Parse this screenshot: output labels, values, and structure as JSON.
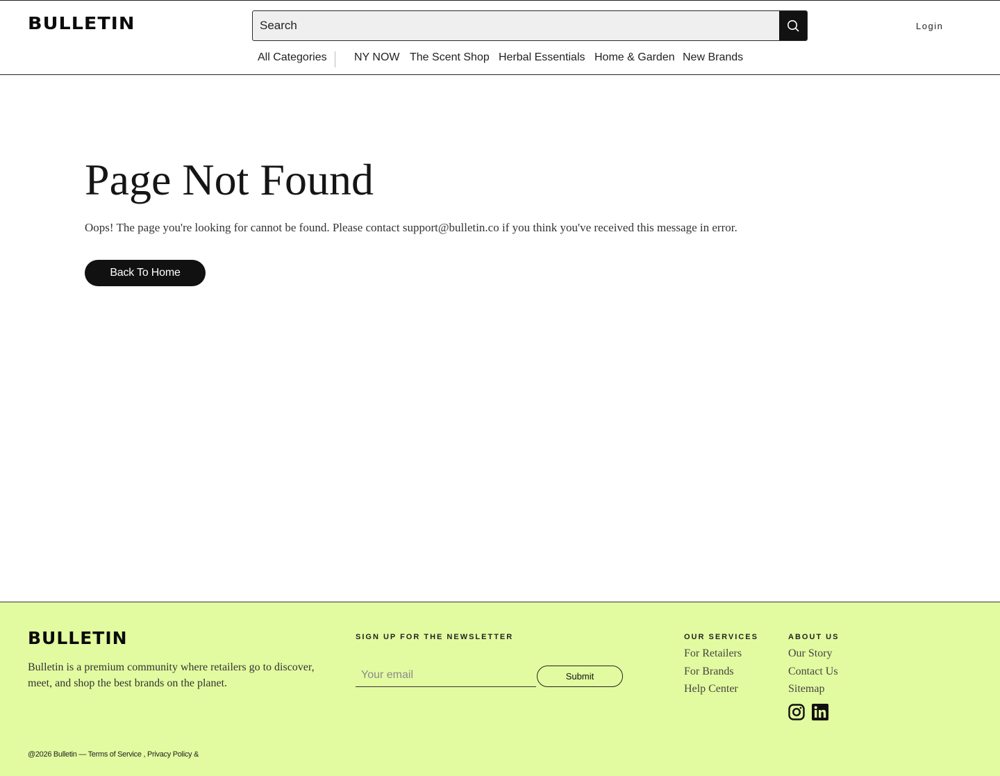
{
  "header": {
    "logo": "BULLETIN",
    "search": {
      "placeholder": "Search"
    },
    "login_label": "Login",
    "nav": [
      {
        "label": "All Categories"
      },
      {
        "label": "NY NOW"
      },
      {
        "label": "The Scent Shop"
      },
      {
        "label": "Herbal Essentials"
      },
      {
        "label": "Home & Garden"
      },
      {
        "label": "New Brands"
      }
    ]
  },
  "main": {
    "title": "Page Not Found",
    "message": "Oops! The page you're looking for cannot be found. Please contact support@bulletin.co if you think you've received this message in error.",
    "button_label": "Back To Home"
  },
  "footer": {
    "logo": "BULLETIN",
    "description": "Bulletin is a premium community where retailers go to discover, meet, and shop the best brands on the planet.",
    "newsletter": {
      "heading": "SIGN UP FOR THE NEWSLETTER",
      "email_placeholder": "Your email",
      "submit_label": "Submit"
    },
    "services": {
      "heading": "OUR SERVICES",
      "links": [
        "For Retailers",
        "For Brands",
        "Help Center"
      ]
    },
    "about": {
      "heading": "ABOUT US",
      "links": [
        "Our Story",
        "Contact Us",
        "Sitemap"
      ]
    },
    "social": [
      "instagram-icon",
      "linkedin-icon"
    ],
    "legal": {
      "copyright": "@2026 Bulletin — ",
      "terms": "Terms of Service",
      "separator": " , ",
      "privacy": "Privacy Policy &"
    }
  },
  "colors": {
    "footer_bg": "#e3fba0",
    "primary": "#111111"
  }
}
